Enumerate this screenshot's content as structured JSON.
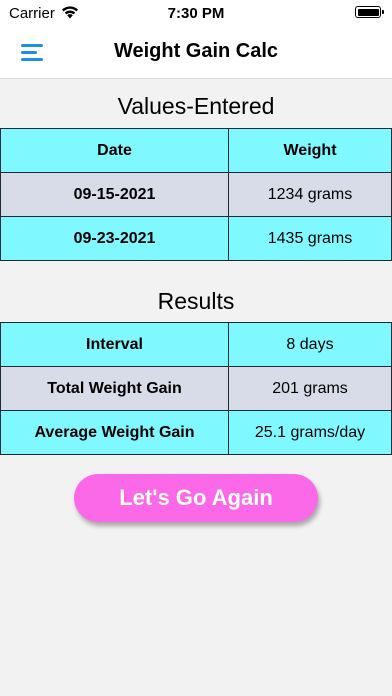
{
  "status_bar": {
    "carrier": "Carrier",
    "time": "7:30 PM"
  },
  "nav": {
    "title": "Weight Gain Calc",
    "menu_icon": "hamburger-menu-icon"
  },
  "values_section": {
    "title": "Values-Entered",
    "headers": [
      "Date",
      "Weight"
    ],
    "rows": [
      {
        "date": "09-15-2021",
        "weight": "1234 grams"
      },
      {
        "date": "09-23-2021",
        "weight": "1435 grams"
      }
    ]
  },
  "results_section": {
    "title": "Results",
    "rows": [
      {
        "label": "Interval",
        "value": "8 days"
      },
      {
        "label": "Total Weight Gain",
        "value": "201 grams"
      },
      {
        "label": "Average Weight Gain",
        "value": "25.1 grams/day"
      }
    ]
  },
  "again_button": {
    "label": "Let's Go Again"
  },
  "colors": {
    "cyan_row": "#7ff9ff",
    "gray_row": "#d8dce8",
    "button": "#fb68e8",
    "menu_icon": "#1e8fe5"
  }
}
